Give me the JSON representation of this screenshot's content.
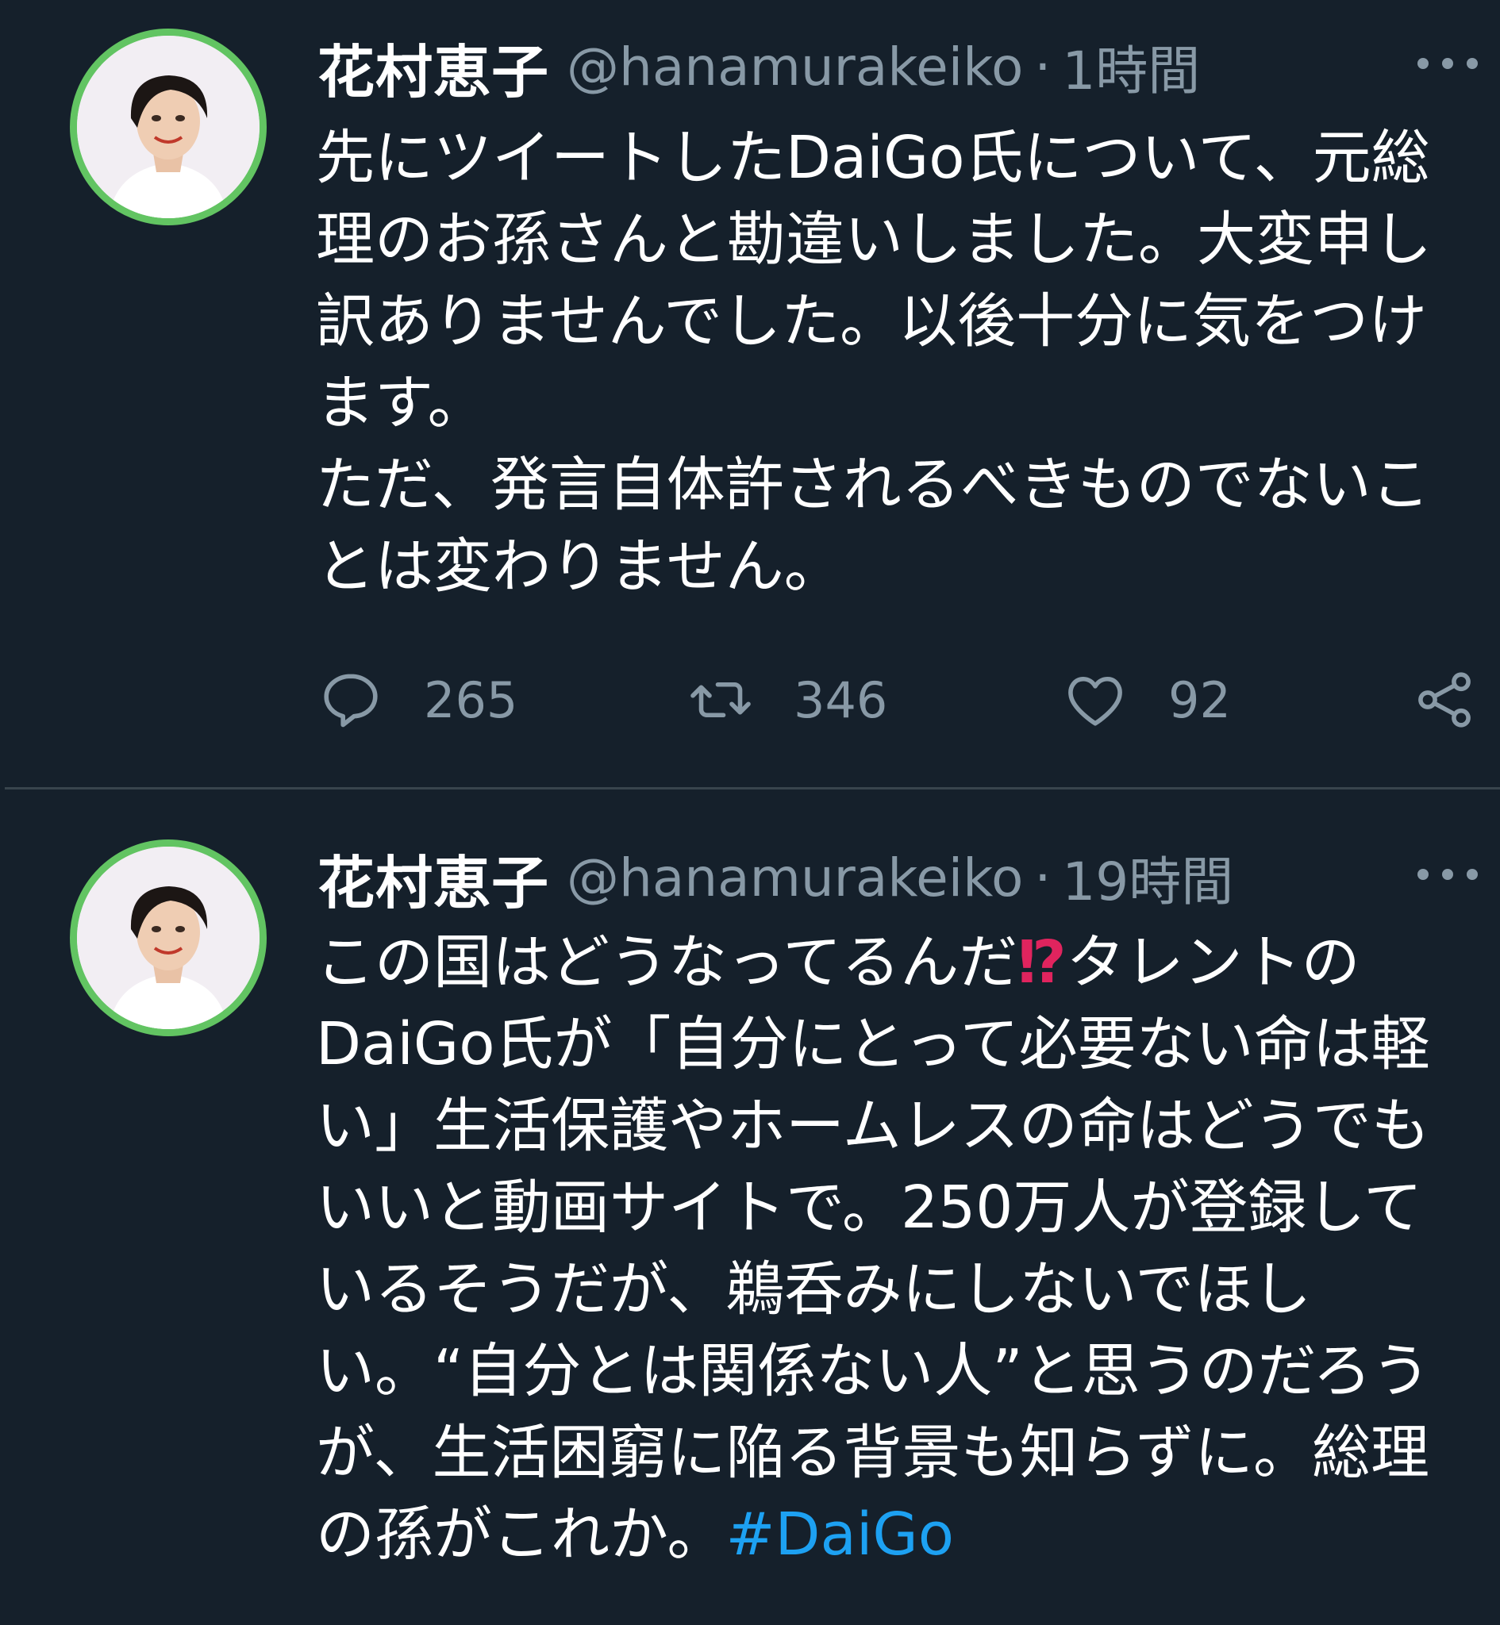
{
  "tweets": [
    {
      "name": "花村恵子",
      "handle": "@hanamurakeiko",
      "separator": "·",
      "time": "1時間",
      "lines": [
        "先にツイートしたDaiGo氏について、元総",
        "理のお孫さんと勘違いしました。大変申し",
        "訳ありませんでした。以後十分に気をつけ",
        "ます。",
        "ただ、発言自体許されるべきものでないこ",
        "とは変わりません。"
      ],
      "reply_count": "265",
      "retweet_count": "346",
      "like_count": "92"
    },
    {
      "name": "花村恵子",
      "handle": "@hanamurakeiko",
      "separator": "·",
      "time": "19時間",
      "line1_pre": "この国はどうなってるんだ",
      "line1_emoji": "⁉",
      "line1_post": "タレントの",
      "lines": [
        "DaiGo氏が「自分にとって必要ない命は軽",
        "い」生活保護やホームレスの命はどうでも",
        "いいと動画サイトで。250万人が登録して",
        "いるそうだが、鵜呑みにしないでほし",
        "い。“自分とは関係ない人”と思うのだろう",
        "が、生活困窮に陥る背景も知らずに。総理"
      ],
      "last_line_pre": "の孫がこれか。",
      "hashtag": "#DaiGo"
    }
  ],
  "colors": {
    "background": "#15202b",
    "secondary_text": "#8899a6",
    "link": "#1da1f2",
    "avatar_ring": "#62c462",
    "divider": "#38444d"
  },
  "icons": [
    "reply-icon",
    "retweet-icon",
    "like-icon",
    "share-icon",
    "more-icon"
  ]
}
